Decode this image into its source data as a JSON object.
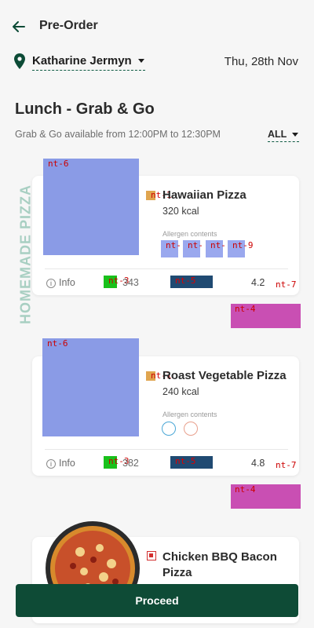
{
  "header": {
    "title": "Pre-Order"
  },
  "location": {
    "name": "Katharine Jermyn",
    "date": "Thu, 28th Nov"
  },
  "section": {
    "title": "Lunch - Grab & Go",
    "subtitle": "Grab & Go available from 12:00PM to 12:30PM",
    "filter": "ALL",
    "side_label": "HOMEMADE PIZZA"
  },
  "labels": {
    "info": "Info",
    "allergen": "Allergen contents",
    "img": "nt-6",
    "veg": "nt-1",
    "green": "nt-3",
    "navy": "nt-5",
    "star": "nt-7",
    "pink": "nt-4",
    "alg1": "nt-",
    "alg2": "nt-",
    "alg3": "nt-",
    "alg4": "nt-9"
  },
  "items": [
    {
      "name": "Hawaiian Pizza",
      "kcal": "320 kcal",
      "count": "343",
      "rating": "4.2"
    },
    {
      "name": "Roast Vegetable Pizza",
      "kcal": "240 kcal",
      "count": "382",
      "rating": "4.8"
    },
    {
      "name": "Chicken BBQ Bacon Pizza"
    }
  ],
  "footer": {
    "proceed": "Proceed"
  },
  "colors": {
    "brand": "#0e4b36",
    "accent_veg": "#e0a54f",
    "non_veg": "#d32f2f"
  }
}
